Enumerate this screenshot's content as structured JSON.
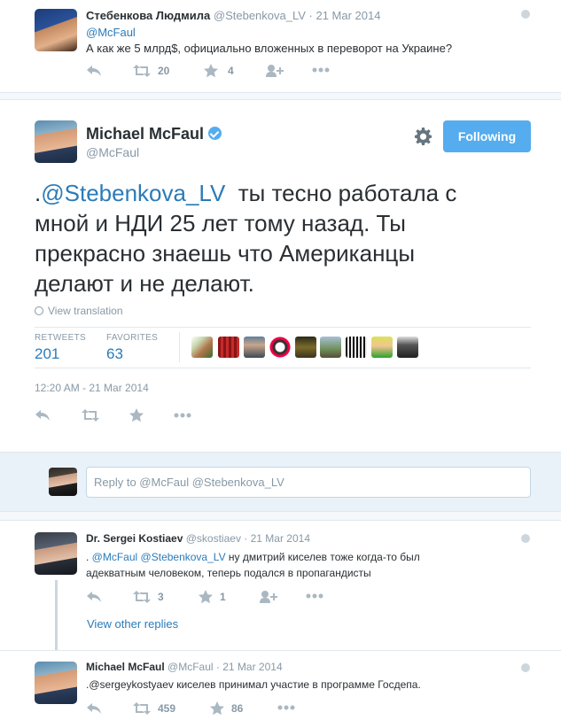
{
  "tweet1": {
    "name": "Стебенкова Людмила",
    "handle": "@Stebenkova_LV",
    "date": "· 21 Mar 2014",
    "line1": "@McFaul",
    "line2": "А как же 5 млрд$, официально вложенных в переворот на Украине?",
    "retweets": "20",
    "favorites": "4"
  },
  "main": {
    "name": "Michael McFaul",
    "handle": "@McFaul",
    "follow_label": "Following",
    "text_prefix": ".",
    "text_mention": "@Stebenkova_LV",
    "text_rest_1": "  ты тесно работала с",
    "text_line2": "мной и НДИ 25 лет тому назад. Ты",
    "text_line3": "прекрасно знаешь что Американцы",
    "text_line4": "делают и не делают.",
    "translate": "View translation",
    "retweets_label": "RETWEETS",
    "retweets_count": "201",
    "favorites_label": "FAVORITES",
    "favorites_count": "63",
    "timestamp": "12:20 AM - 21 Mar 2014"
  },
  "reply_box": {
    "text": "Reply to @McFaul @Stebenkova_LV"
  },
  "reply1": {
    "name": "Dr. Sergei Kostiaev",
    "handle": "@skostiaev",
    "date": "· 21 Mar 2014",
    "prefix": ". ",
    "mention1": "@McFaul",
    "mention2": "@Stebenkova_LV",
    "text1": " ну дмитрий киселев тоже когда-то был",
    "text2": "адекватным человеком, теперь подался в пропагандисты",
    "retweets": "3",
    "favorites": "1"
  },
  "view_other": "View other replies",
  "reply2": {
    "name": "Michael McFaul",
    "handle": "@McFaul",
    "date": "· 21 Mar 2014",
    "text": ".@sergeykostyaev киселев принимал участие в программе Госдепа.",
    "retweets": "459",
    "favorites": "86"
  },
  "colors": {
    "link": "#2b7bb9",
    "follow_button": "#55acee",
    "muted": "#8899a6",
    "reply_bg": "#e8f2f8"
  }
}
